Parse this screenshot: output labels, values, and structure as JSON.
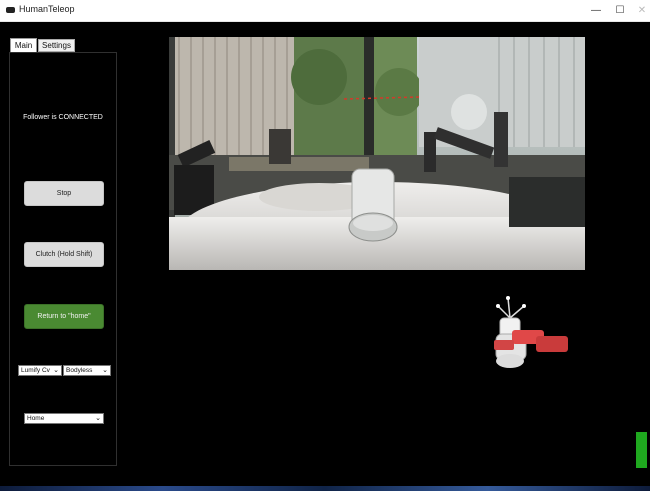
{
  "window": {
    "title": "HumanTeleop",
    "minimize_glyph": "—",
    "maximize_glyph": "☐",
    "close_glyph": "✕"
  },
  "tabs": [
    {
      "label": "Main",
      "active": true
    },
    {
      "label": "Settings",
      "active": false
    }
  ],
  "sidebar": {
    "status": "Follower is CONNECTED",
    "stop_label": "Stop",
    "clutch_label": "Clutch (Hold Shift)",
    "home_label": "Return to \"home\"",
    "camera_select": "Lumify Cv",
    "body_select": "Bodyless",
    "pose_select": "Home"
  },
  "colors": {
    "home_button": "#4a8a32",
    "status_bar": "#1fa81f",
    "background": "#000000"
  },
  "icons": {
    "app": "app-icon",
    "dropdown": "chevron-down-icon"
  }
}
